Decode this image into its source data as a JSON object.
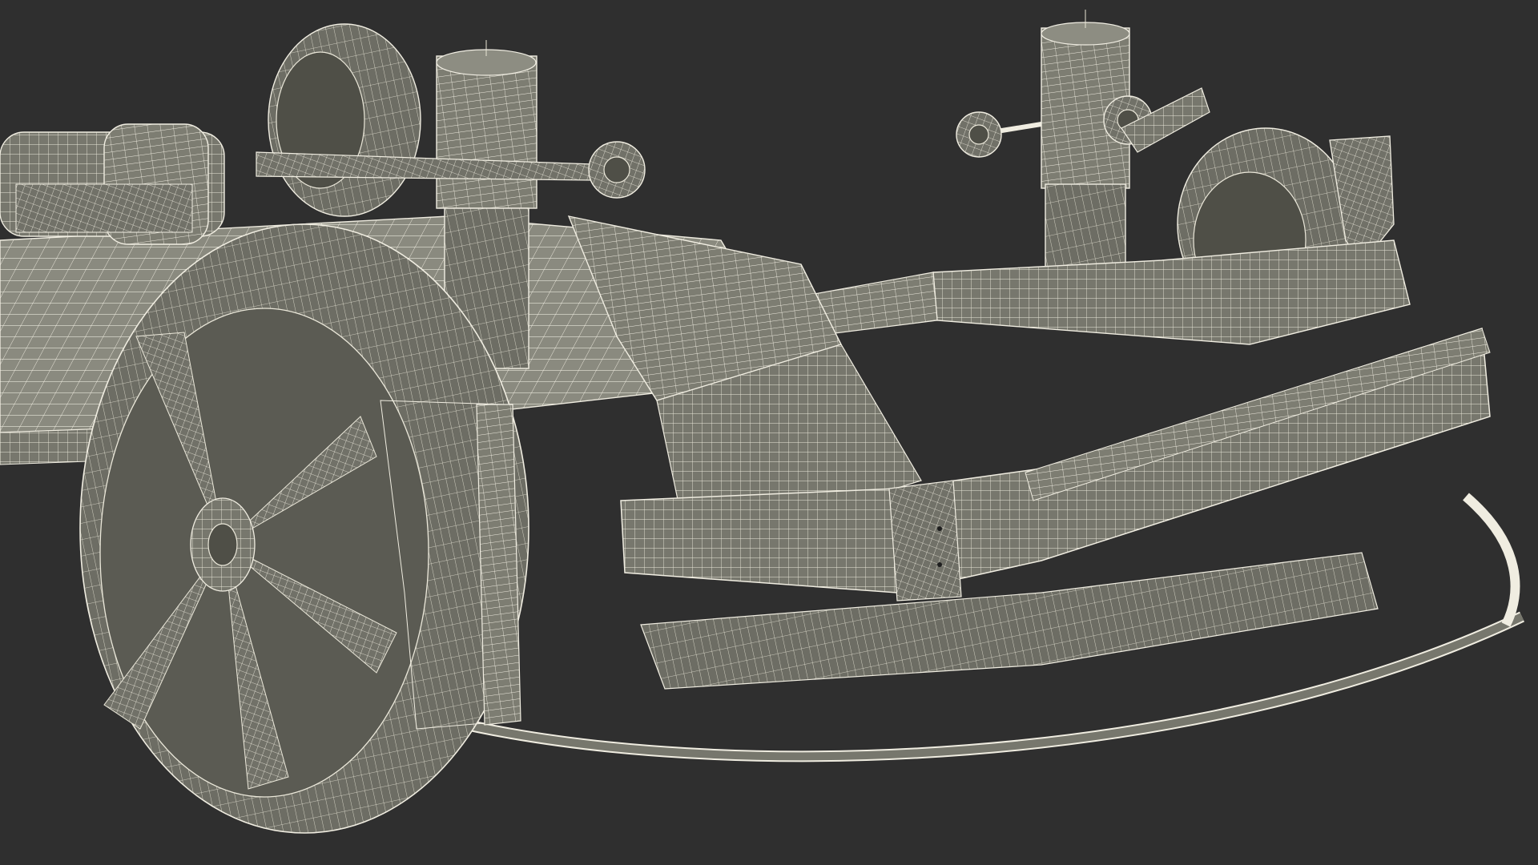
{
  "scene": {
    "background_color": "#2f2f2f",
    "wire_color": "#e9e6d6",
    "mesh_color": "#7a7a6f"
  }
}
